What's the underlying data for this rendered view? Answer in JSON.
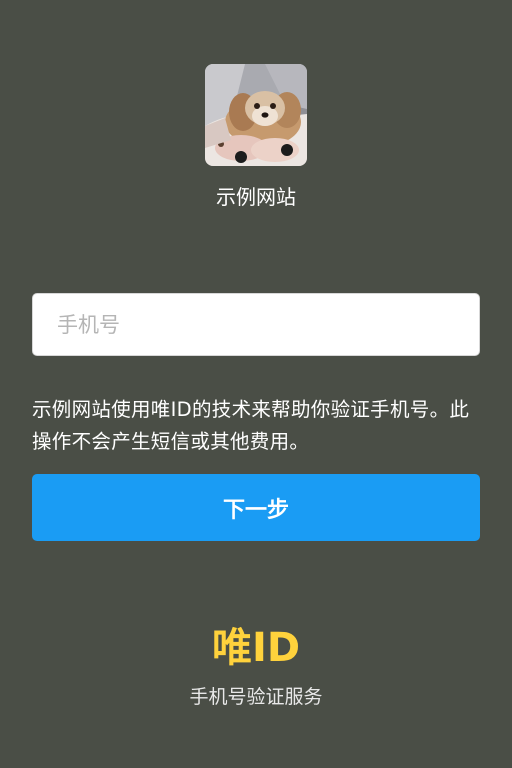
{
  "app": {
    "name": "示例网站",
    "logo_icon": "dog-photo-icon"
  },
  "form": {
    "phone_placeholder": "手机号",
    "phone_value": ""
  },
  "notice": {
    "text": "示例网站使用唯ID的技术来帮助你验证手机号。此操作不会产生短信或其他费用。"
  },
  "actions": {
    "next_label": "下一步"
  },
  "footer": {
    "brand": "唯ID",
    "service": "手机号验证服务"
  },
  "colors": {
    "background": "#4a4e46",
    "primary_button": "#1a9cf4",
    "brand": "#ffd23c"
  }
}
